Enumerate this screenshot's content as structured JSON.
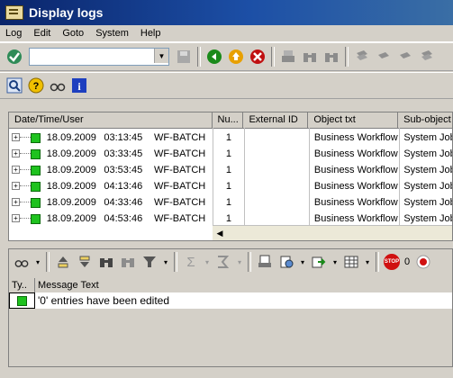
{
  "window": {
    "title": "Display logs"
  },
  "menu": [
    "Log",
    "Edit",
    "Goto",
    "System",
    "Help"
  ],
  "command_field": {
    "value": ""
  },
  "columns": [
    "Date/Time/User",
    "Nu...",
    "External ID",
    "Object txt",
    "Sub-object"
  ],
  "rows": [
    {
      "date": "18.09.2009",
      "time": "03:13:45",
      "user": "WF-BATCH",
      "num": "1",
      "ext": "",
      "obj": "Business Workflow",
      "sub": "System Job"
    },
    {
      "date": "18.09.2009",
      "time": "03:33:45",
      "user": "WF-BATCH",
      "num": "1",
      "ext": "",
      "obj": "Business Workflow",
      "sub": "System Job"
    },
    {
      "date": "18.09.2009",
      "time": "03:53:45",
      "user": "WF-BATCH",
      "num": "1",
      "ext": "",
      "obj": "Business Workflow",
      "sub": "System Job"
    },
    {
      "date": "18.09.2009",
      "time": "04:13:46",
      "user": "WF-BATCH",
      "num": "1",
      "ext": "",
      "obj": "Business Workflow",
      "sub": "System Job"
    },
    {
      "date": "18.09.2009",
      "time": "04:33:46",
      "user": "WF-BATCH",
      "num": "1",
      "ext": "",
      "obj": "Business Workflow",
      "sub": "System Job"
    },
    {
      "date": "18.09.2009",
      "time": "04:53:46",
      "user": "WF-BATCH",
      "num": "1",
      "ext": "",
      "obj": "Business Workflow",
      "sub": "System Job"
    }
  ],
  "messages": {
    "columns": [
      "Ty..",
      "Message Text"
    ],
    "stop_count": "0",
    "rows": [
      {
        "text": "'0' entries have been edited"
      }
    ]
  }
}
